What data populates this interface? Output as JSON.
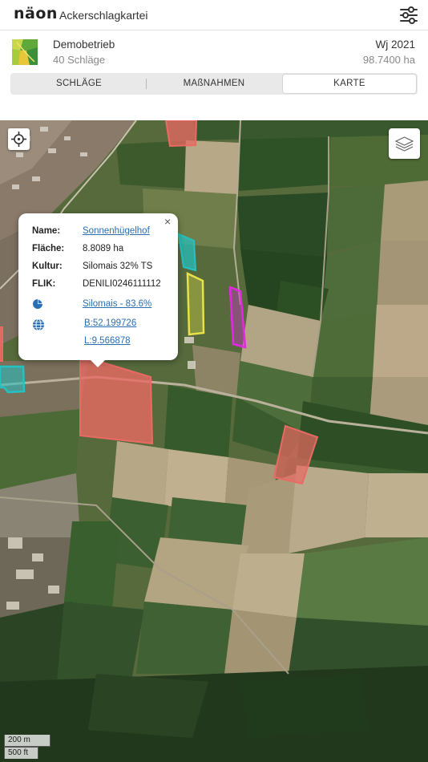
{
  "header": {
    "logo": "näon",
    "title": "Ackerschlagkartei",
    "menu_icon": "sliders-icon"
  },
  "farm": {
    "name": "Demobetrieb",
    "plot_count": "40 Schläge",
    "year": "Wj 2021",
    "area": "98.7400 ha"
  },
  "tabs": [
    {
      "label": "SCHLÄGE",
      "active": false
    },
    {
      "label": "MAßNAHMEN",
      "active": false
    },
    {
      "label": "KARTE",
      "active": true
    }
  ],
  "map": {
    "locate_icon": "crosshair-icon",
    "layers_icon": "layers-icon",
    "scale_metric": "200 m",
    "scale_imperial": "500 ft",
    "field_colors": {
      "selected": "#e96a63",
      "teal": "#22c3c2",
      "yellow": "#e8e24a",
      "magenta": "#e327e3",
      "red": "#e96a63"
    }
  },
  "popup": {
    "name_label": "Name:",
    "name_value": "Sonnenhügelhof",
    "area_label": "Fläche:",
    "area_value": "8.8089 ha",
    "crop_label": "Kultur:",
    "crop_value": "Silomais 32% TS",
    "flik_label": "FLIK:",
    "flik_value": "DENILI0246111112",
    "share_link": "Silomais - 83.6%",
    "lat_link": "B:52.199726",
    "lon_link": "L:9.566878",
    "close": "×"
  }
}
